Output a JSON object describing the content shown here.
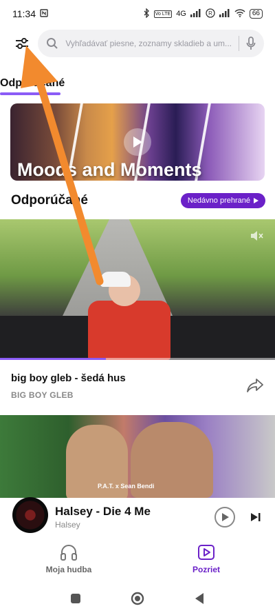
{
  "status_bar": {
    "time": "11:34",
    "signal_4g": "4G",
    "volte": "Vo LTE",
    "battery": "66"
  },
  "search": {
    "placeholder": "Vyhľadávať piesne, zoznamy skladieb a um..."
  },
  "tabs": {
    "active_label": "Odporúčané"
  },
  "banner": {
    "title": "Moods and Moments"
  },
  "section": {
    "title": "Odporúčané",
    "recent_button": "Nedávno prehrané"
  },
  "video1": {
    "title": "big boy gleb -  šedá hus",
    "artist": "BIG BOY GLEB",
    "progress": 0.385
  },
  "video2": {
    "caption": "P.A.T. x Sean Bendi"
  },
  "mini_player": {
    "title": "Halsey - Die 4 Me",
    "artist": "Halsey"
  },
  "bottom_nav": {
    "my_music": "Moja hudba",
    "watch": "Pozriet"
  },
  "colors": {
    "accent": "#6b21c8",
    "tab_underline": "#8b5cf6",
    "annotation_arrow": "#f28a2e"
  }
}
